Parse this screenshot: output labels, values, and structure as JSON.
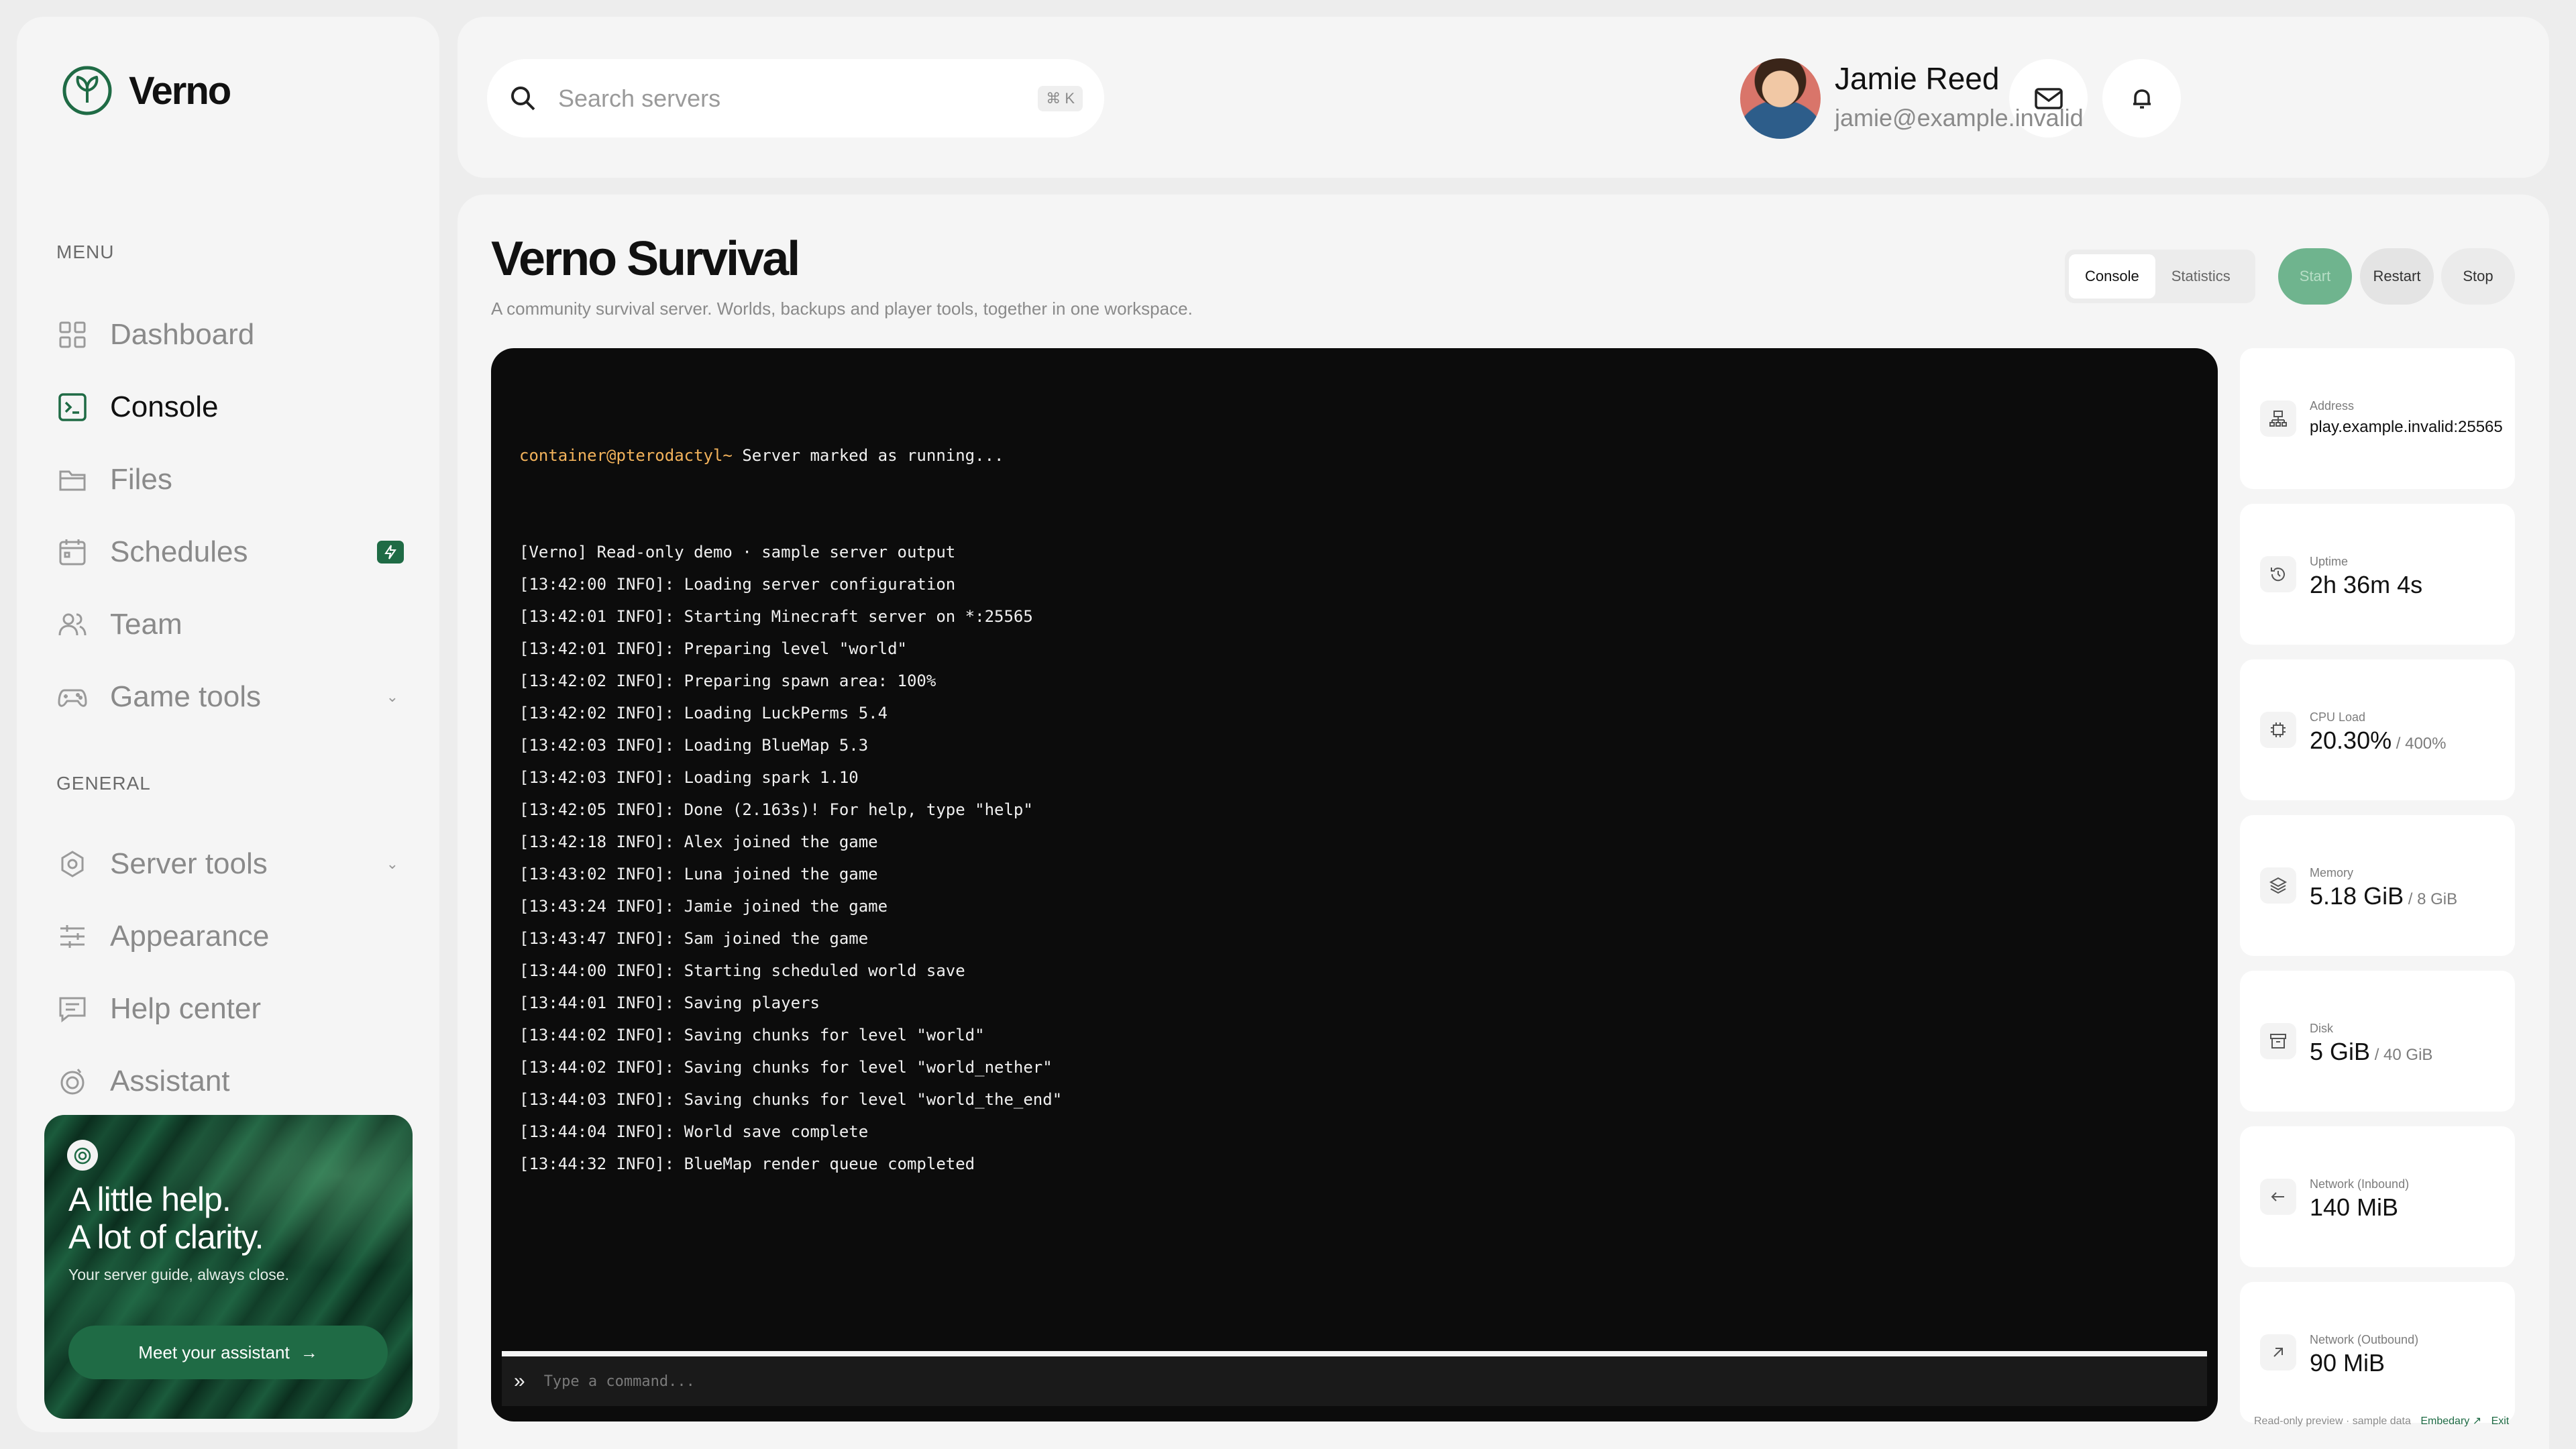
{
  "app": {
    "name": "Verno"
  },
  "sidebar": {
    "menu_label": "MENU",
    "general_label": "GENERAL",
    "menu_items": [
      {
        "label": "Dashboard",
        "icon": "grid-icon",
        "active": false
      },
      {
        "label": "Console",
        "icon": "terminal-icon",
        "active": true
      },
      {
        "label": "Files",
        "icon": "folder-icon",
        "active": false
      },
      {
        "label": "Schedules",
        "icon": "calendar-icon",
        "active": false,
        "badge_icon": "bolt-icon"
      },
      {
        "label": "Team",
        "icon": "users-icon",
        "active": false
      },
      {
        "label": "Game tools",
        "icon": "gamepad-icon",
        "active": false,
        "has_dropdown": true
      }
    ],
    "general_items": [
      {
        "label": "Server tools",
        "icon": "gear-icon",
        "has_dropdown": true
      },
      {
        "label": "Appearance",
        "icon": "sliders-icon"
      },
      {
        "label": "Help center",
        "icon": "chat-icon"
      },
      {
        "label": "Assistant",
        "icon": "assistant-icon"
      }
    ],
    "promo": {
      "title_line1": "A little help.",
      "title_line2": "A lot of clarity.",
      "subtitle": "Your server guide, always close.",
      "button_label": "Meet your assistant"
    }
  },
  "topbar": {
    "search_placeholder": "Search servers",
    "search_shortcut": "⌘ K",
    "user": {
      "name": "Jamie Reed",
      "email": "jamie@example.invalid"
    }
  },
  "server": {
    "title": "Verno Survival",
    "subtitle": "A community survival server. Worlds, backups and player tools, together in one workspace.",
    "tabs": [
      {
        "label": "Console",
        "active": true
      },
      {
        "label": "Statistics",
        "active": false
      }
    ],
    "actions": {
      "start": "Start",
      "restart": "Restart",
      "stop": "Stop"
    }
  },
  "console": {
    "prompt_user": "container@pterodactyl~",
    "prompt_text": " Server marked as running...",
    "lines": [
      "[Verno] Read-only demo · sample server output",
      "[13:42:00 INFO]: Loading server configuration",
      "[13:42:01 INFO]: Starting Minecraft server on *:25565",
      "[13:42:01 INFO]: Preparing level \"world\"",
      "[13:42:02 INFO]: Preparing spawn area: 100%",
      "[13:42:02 INFO]: Loading LuckPerms 5.4",
      "[13:42:03 INFO]: Loading BlueMap 5.3",
      "[13:42:03 INFO]: Loading spark 1.10",
      "[13:42:05 INFO]: Done (2.163s)! For help, type \"help\"",
      "[13:42:18 INFO]: Alex joined the game",
      "[13:43:02 INFO]: Luna joined the game",
      "[13:43:24 INFO]: Jamie joined the game",
      "[13:43:47 INFO]: Sam joined the game",
      "[13:44:00 INFO]: Starting scheduled world save",
      "[13:44:01 INFO]: Saving players",
      "[13:44:02 INFO]: Saving chunks for level \"world\"",
      "[13:44:02 INFO]: Saving chunks for level \"world_nether\"",
      "[13:44:03 INFO]: Saving chunks for level \"world_the_end\"",
      "[13:44:04 INFO]: World save complete",
      "[13:44:32 INFO]: BlueMap render queue completed"
    ],
    "command_placeholder": "Type a command..."
  },
  "stats": [
    {
      "label": "Address",
      "value": "play.example.invalid:25565",
      "of": "",
      "icon": "network-icon"
    },
    {
      "label": "Uptime",
      "value": "2h 36m 4s",
      "of": "",
      "icon": "history-icon"
    },
    {
      "label": "CPU Load",
      "value": "20.30%",
      "of": " / 400%",
      "icon": "cpu-icon"
    },
    {
      "label": "Memory",
      "value": "5.18 GiB",
      "of": " / 8 GiB",
      "icon": "layers-icon"
    },
    {
      "label": "Disk",
      "value": "5 GiB",
      "of": " / 40 GiB",
      "icon": "archive-icon"
    },
    {
      "label": "Network (Inbound)",
      "value": "140 MiB",
      "of": "",
      "icon": "arrow-left-icon"
    },
    {
      "label": "Network (Outbound)",
      "value": "90 MiB",
      "of": "",
      "icon": "arrow-up-right-icon"
    }
  ],
  "footer": {
    "note": "Read-only preview · sample data",
    "link": "Embedary ↗",
    "exit": "Exit"
  },
  "colors": {
    "accent": "#1f6b45",
    "start_button": "#6fb48e",
    "console_bg": "#0c0c0c",
    "prompt_user": "#f2b25b"
  }
}
